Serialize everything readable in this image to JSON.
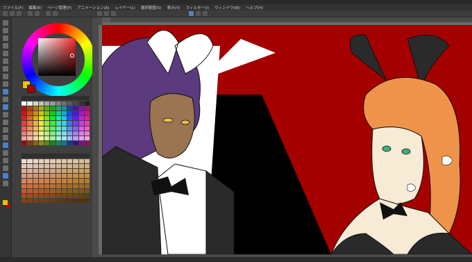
{
  "window": {
    "title": ""
  },
  "menu": [
    "ファイル(F)",
    "編集(E)",
    "ページ管理(P)",
    "アニメーション(A)",
    "レイヤー(L)",
    "選択範囲(S)",
    "表示(V)",
    "フィルター(I)",
    "ウィンドウ(W)",
    "ヘルプ(H)"
  ],
  "canvas": {
    "tab_label": ""
  },
  "colors": {
    "main_color": "#f0c000",
    "sub_color": "#a50000",
    "art_background": "#a50000",
    "art_shadow": "#000000"
  },
  "palette_panel": {
    "title": ""
  },
  "skin_palette_panel": {
    "title": ""
  },
  "icons": [
    "tool-icon",
    "color-wheel",
    "swatch"
  ]
}
